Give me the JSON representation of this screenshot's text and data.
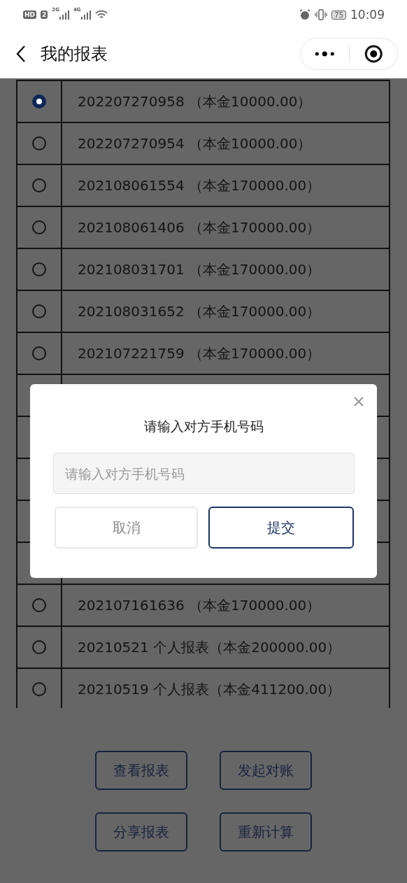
{
  "status_bar": {
    "hd": "HD",
    "sim": "2",
    "signals": [
      "2G",
      "4G"
    ],
    "battery": "75",
    "time": "10:09"
  },
  "header": {
    "title": "我的报表"
  },
  "reports": [
    {
      "label": "202207270958 （本金10000.00）",
      "selected": true
    },
    {
      "label": "202207270954 （本金10000.00）",
      "selected": false
    },
    {
      "label": "202108061554 （本金170000.00）",
      "selected": false
    },
    {
      "label": "202108061406 （本金170000.00）",
      "selected": false
    },
    {
      "label": "202108031701 （本金170000.00）",
      "selected": false
    },
    {
      "label": "202108031652 （本金170000.00）",
      "selected": false
    },
    {
      "label": "202107221759 （本金170000.00）",
      "selected": false
    },
    {
      "label": "202107161636 （本金170000.00）",
      "selected": false
    },
    {
      "label": "20210521 个人报表（本金200000.00）",
      "selected": false
    },
    {
      "label": "20210519 个人报表（本金411200.00）",
      "selected": false
    }
  ],
  "dialog": {
    "title": "请输入对方手机号码",
    "input": {
      "placeholder": "请输入对方手机号码"
    },
    "buttons": [
      {
        "label": "取消",
        "kind": "cancel"
      },
      {
        "label": "提交",
        "kind": "submit"
      }
    ]
  },
  "actions": [
    "查看报表",
    "发起对账",
    "分享报表",
    "重新计算"
  ]
}
